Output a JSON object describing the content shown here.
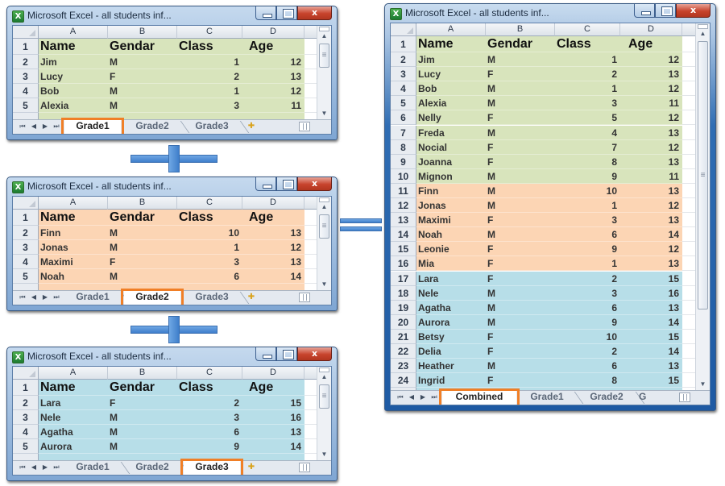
{
  "window_title": "Microsoft Excel - all students inf...",
  "window_controls": {
    "minimize": "minimize",
    "maximize": "maximize",
    "close": "x"
  },
  "columns": [
    "A",
    "B",
    "C",
    "D"
  ],
  "headers": [
    "Name",
    "Gendar",
    "Class",
    "Age"
  ],
  "colors": {
    "grade1_fill": "#d8e4bc",
    "grade2_fill": "#fcd5b4",
    "grade3_fill": "#b7dee8",
    "tab_highlight": "#f07f27",
    "operator_blue": "#4f8fd6"
  },
  "operators": {
    "plus": "+",
    "equals": "="
  },
  "small_windows": [
    {
      "id": "grade1",
      "active_tab": "Grade1",
      "tabs": [
        "Grade1",
        "Grade2",
        "Grade3"
      ],
      "fill": "grade1",
      "rows": [
        {
          "n": "1"
        },
        {
          "n": "2",
          "name": "Jim",
          "gender": "M",
          "class": "1",
          "age": "12"
        },
        {
          "n": "3",
          "name": "Lucy",
          "gender": "F",
          "class": "2",
          "age": "13"
        },
        {
          "n": "4",
          "name": "Bob",
          "gender": "M",
          "class": "1",
          "age": "12"
        },
        {
          "n": "5",
          "name": "Alexia",
          "gender": "M",
          "class": "3",
          "age": "11"
        }
      ]
    },
    {
      "id": "grade2",
      "active_tab": "Grade2",
      "tabs": [
        "Grade1",
        "Grade2",
        "Grade3"
      ],
      "fill": "grade2",
      "rows": [
        {
          "n": "1"
        },
        {
          "n": "2",
          "name": "Finn",
          "gender": "M",
          "class": "10",
          "age": "13"
        },
        {
          "n": "3",
          "name": "Jonas",
          "gender": "M",
          "class": "1",
          "age": "12"
        },
        {
          "n": "4",
          "name": "Maximi",
          "gender": "F",
          "class": "3",
          "age": "13"
        },
        {
          "n": "5",
          "name": "Noah",
          "gender": "M",
          "class": "6",
          "age": "14"
        }
      ]
    },
    {
      "id": "grade3",
      "active_tab": "Grade3",
      "tabs": [
        "Grade1",
        "Grade2",
        "Grade3"
      ],
      "fill": "grade3",
      "rows": [
        {
          "n": "1"
        },
        {
          "n": "2",
          "name": "Lara",
          "gender": "F",
          "class": "2",
          "age": "15"
        },
        {
          "n": "3",
          "name": "Nele",
          "gender": "M",
          "class": "3",
          "age": "16"
        },
        {
          "n": "4",
          "name": "Agatha",
          "gender": "M",
          "class": "6",
          "age": "13"
        },
        {
          "n": "5",
          "name": "Aurora",
          "gender": "M",
          "class": "9",
          "age": "14"
        }
      ]
    }
  ],
  "combined_window": {
    "active_tab": "Combined",
    "tabs": [
      "Combined",
      "Grade1",
      "Grade2",
      "G"
    ],
    "rows": [
      {
        "n": "1",
        "fill": "grade1"
      },
      {
        "n": "2",
        "name": "Jim",
        "gender": "M",
        "class": "1",
        "age": "12",
        "fill": "grade1"
      },
      {
        "n": "3",
        "name": "Lucy",
        "gender": "F",
        "class": "2",
        "age": "13",
        "fill": "grade1"
      },
      {
        "n": "4",
        "name": "Bob",
        "gender": "M",
        "class": "1",
        "age": "12",
        "fill": "grade1"
      },
      {
        "n": "5",
        "name": "Alexia",
        "gender": "M",
        "class": "3",
        "age": "11",
        "fill": "grade1"
      },
      {
        "n": "6",
        "name": "Nelly",
        "gender": "F",
        "class": "5",
        "age": "12",
        "fill": "grade1"
      },
      {
        "n": "7",
        "name": "Freda",
        "gender": "M",
        "class": "4",
        "age": "13",
        "fill": "grade1"
      },
      {
        "n": "8",
        "name": "Nocial",
        "gender": "F",
        "class": "7",
        "age": "12",
        "fill": "grade1"
      },
      {
        "n": "9",
        "name": "Joanna",
        "gender": "F",
        "class": "8",
        "age": "13",
        "fill": "grade1"
      },
      {
        "n": "10",
        "name": "Mignon",
        "gender": "M",
        "class": "9",
        "age": "11",
        "fill": "grade1"
      },
      {
        "n": "11",
        "name": "Finn",
        "gender": "M",
        "class": "10",
        "age": "13",
        "fill": "grade2"
      },
      {
        "n": "12",
        "name": "Jonas",
        "gender": "M",
        "class": "1",
        "age": "12",
        "fill": "grade2"
      },
      {
        "n": "13",
        "name": "Maximi",
        "gender": "F",
        "class": "3",
        "age": "13",
        "fill": "grade2"
      },
      {
        "n": "14",
        "name": "Noah",
        "gender": "M",
        "class": "6",
        "age": "14",
        "fill": "grade2"
      },
      {
        "n": "15",
        "name": "Leonie",
        "gender": "F",
        "class": "9",
        "age": "12",
        "fill": "grade2"
      },
      {
        "n": "16",
        "name": "Mia",
        "gender": "F",
        "class": "1",
        "age": "13",
        "fill": "grade2"
      },
      {
        "n": "17",
        "name": "Lara",
        "gender": "F",
        "class": "2",
        "age": "15",
        "fill": "grade3"
      },
      {
        "n": "18",
        "name": "Nele",
        "gender": "M",
        "class": "3",
        "age": "16",
        "fill": "grade3"
      },
      {
        "n": "19",
        "name": "Agatha",
        "gender": "M",
        "class": "6",
        "age": "13",
        "fill": "grade3"
      },
      {
        "n": "20",
        "name": "Aurora",
        "gender": "M",
        "class": "9",
        "age": "14",
        "fill": "grade3"
      },
      {
        "n": "21",
        "name": "Betsy",
        "gender": "F",
        "class": "10",
        "age": "15",
        "fill": "grade3"
      },
      {
        "n": "22",
        "name": "Delia",
        "gender": "F",
        "class": "2",
        "age": "14",
        "fill": "grade3"
      },
      {
        "n": "23",
        "name": "Heather",
        "gender": "M",
        "class": "6",
        "age": "13",
        "fill": "grade3"
      },
      {
        "n": "24",
        "name": "Ingrid",
        "gender": "F",
        "class": "8",
        "age": "15",
        "fill": "grade3"
      }
    ]
  },
  "icons": {
    "app": "excel-icon",
    "nav": [
      "first-sheet-icon",
      "prev-sheet-icon",
      "next-sheet-icon",
      "last-sheet-icon"
    ],
    "new_sheet": "insert-worksheet-icon"
  }
}
